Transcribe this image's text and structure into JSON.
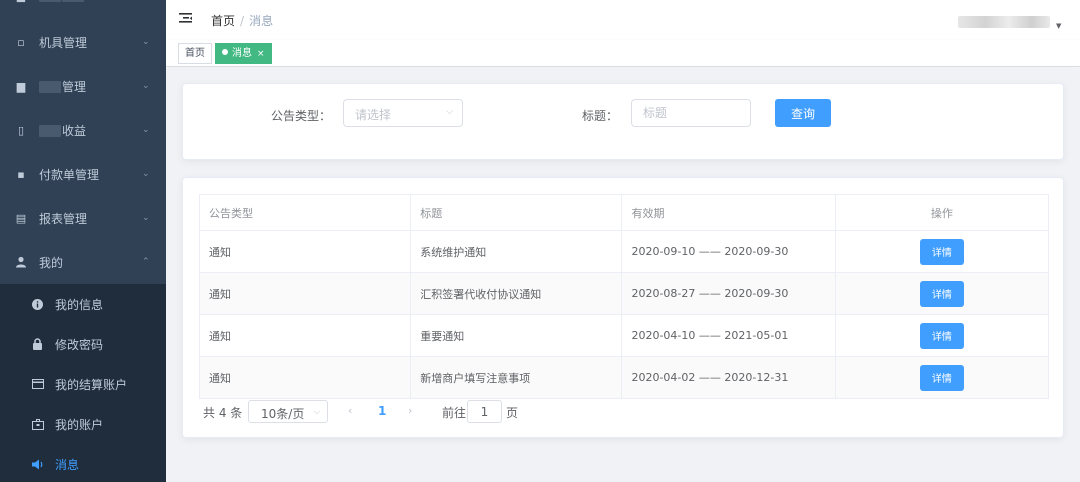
{
  "colors": {
    "sidebar_bg": "#304156",
    "submenu_bg": "#1f2d3d",
    "accent": "#409eff",
    "tag_active": "#42b983"
  },
  "sidebar": {
    "items": [
      {
        "label": "机具管理",
        "icon": "device-icon"
      },
      {
        "label": "管理",
        "icon": "film-icon"
      },
      {
        "label": "收益",
        "icon": "database-icon"
      },
      {
        "label": "付款单管理",
        "icon": "briefcase-icon"
      },
      {
        "label": "报表管理",
        "icon": "chart-icon"
      },
      {
        "label": "我的",
        "icon": "user-icon"
      }
    ],
    "submenu": [
      {
        "label": "我的信息",
        "icon": "info-icon"
      },
      {
        "label": "修改密码",
        "icon": "lock-icon"
      },
      {
        "label": "我的结算账户",
        "icon": "card-icon"
      },
      {
        "label": "我的账户",
        "icon": "wallet-icon"
      },
      {
        "label": "消息",
        "icon": "speaker-icon",
        "active": true
      }
    ]
  },
  "navbar": {
    "breadcrumb": {
      "home": "首页",
      "separator": "/",
      "current": "消息"
    }
  },
  "tags": [
    {
      "label": "首页"
    },
    {
      "label": "消息",
      "close": "×",
      "active": true
    }
  ],
  "search": {
    "type_label": "公告类型：",
    "type_placeholder": "请选择",
    "title_label": "标题：",
    "title_placeholder": "标题",
    "query_button": "查询"
  },
  "table": {
    "headers": [
      "公告类型",
      "标题",
      "有效期",
      "操作"
    ],
    "rows": [
      {
        "type": "通知",
        "title": "系统维护通知",
        "period": "2020-09-10 —— 2020-09-30",
        "action": "详情"
      },
      {
        "type": "通知",
        "title": "汇积签署代收付协议通知",
        "period": "2020-08-27 —— 2020-09-30",
        "action": "详情"
      },
      {
        "type": "通知",
        "title": "重要通知",
        "period": "2020-04-10 —— 2021-05-01",
        "action": "详情"
      },
      {
        "type": "通知",
        "title": "新增商户填写注意事项",
        "period": "2020-04-02 —— 2020-12-31",
        "action": "详情"
      }
    ]
  },
  "pagination": {
    "total": "共 4 条",
    "page_size": "10条/页",
    "current_page": "1",
    "goto_label": "前往",
    "goto_value": "1",
    "page_unit": "页"
  }
}
